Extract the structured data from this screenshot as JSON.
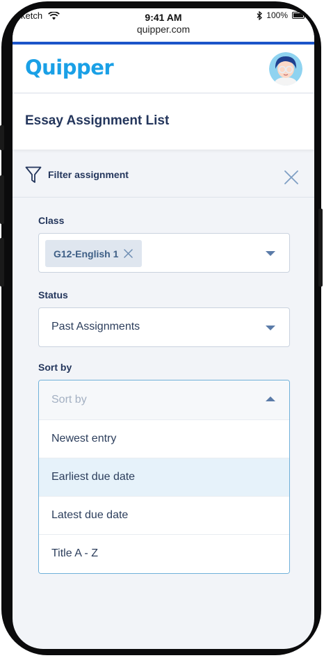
{
  "status_bar": {
    "carrier": "ketch",
    "time": "9:41 AM",
    "url": "quipper.com",
    "battery": "100%"
  },
  "header": {
    "logo_text": "Quipper"
  },
  "page": {
    "title": "Essay Assignment List"
  },
  "filter": {
    "label": "Filter assignment"
  },
  "form": {
    "class_label": "Class",
    "class_chip": "G12-English 1",
    "status_label": "Status",
    "status_value": "Past Assignments",
    "sort_label": "Sort by",
    "sort_placeholder": "Sort by",
    "sort_options": [
      "Newest entry",
      "Earliest due date",
      "Latest due date",
      "Title A - Z"
    ],
    "highlighted_option": "Earliest due date"
  },
  "colors": {
    "brand": "#1aa0e6",
    "accent_line": "#1c55c9",
    "title_text": "#24365c",
    "highlight": "#e6f2fa"
  }
}
